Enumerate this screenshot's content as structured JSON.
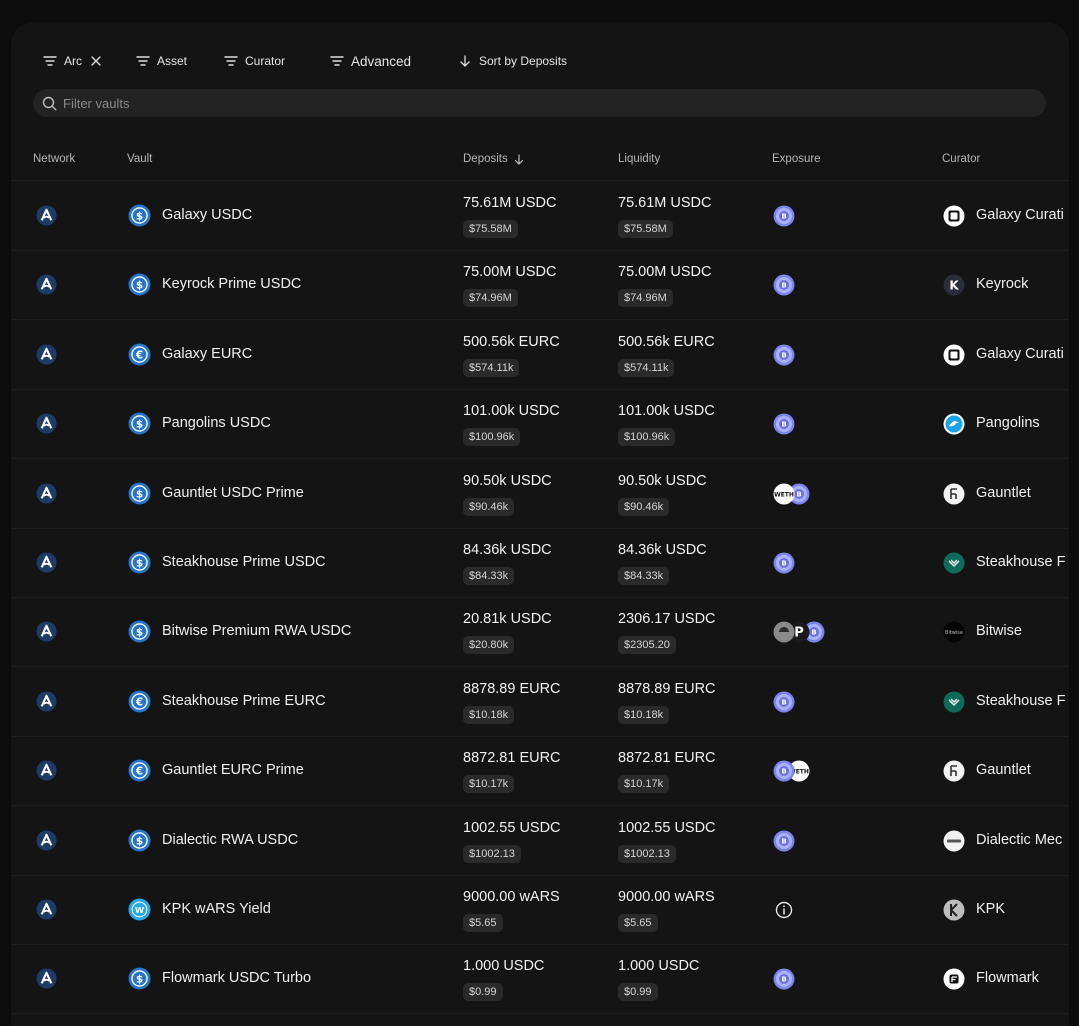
{
  "filters": {
    "network": "Arc",
    "asset": "Asset",
    "curator": "Curator",
    "advanced": "Advanced",
    "sort": "Sort by Deposits"
  },
  "search": {
    "placeholder": "Filter vaults",
    "value": ""
  },
  "columns": {
    "network": "Network",
    "vault": "Vault",
    "deposits": "Deposits",
    "liquidity": "Liquidity",
    "exposure": "Exposure",
    "curator": "Curator"
  },
  "colors": {
    "background": "#0c0c0c",
    "panel": "#141414",
    "usdc_blue": "#2775ca",
    "usd_pill": "#2a2a2a",
    "exposure_purple": "#7b84f0"
  },
  "rows": [
    {
      "network_icon": "arc-network-icon",
      "vault_icon": "usdc-icon",
      "vault": "Galaxy USDC",
      "deposits": "75.61M USDC",
      "deposits_usd": "$75.58M",
      "liquidity": "75.61M USDC",
      "liquidity_usd": "$75.58M",
      "exposure": [
        "rwa-token-icon"
      ],
      "curator_icon": "galaxy-icon",
      "curator": "Galaxy Curati"
    },
    {
      "network_icon": "arc-network-icon",
      "vault_icon": "usdc-icon",
      "vault": "Keyrock Prime USDC",
      "deposits": "75.00M USDC",
      "deposits_usd": "$74.96M",
      "liquidity": "75.00M USDC",
      "liquidity_usd": "$74.96M",
      "exposure": [
        "rwa-token-icon"
      ],
      "curator_icon": "keyrock-icon",
      "curator": "Keyrock"
    },
    {
      "network_icon": "arc-network-icon",
      "vault_icon": "eurc-icon",
      "vault": "Galaxy EURC",
      "deposits": "500.56k EURC",
      "deposits_usd": "$574.11k",
      "liquidity": "500.56k EURC",
      "liquidity_usd": "$574.11k",
      "exposure": [
        "rwa-token-icon"
      ],
      "curator_icon": "galaxy-icon",
      "curator": "Galaxy Curati"
    },
    {
      "network_icon": "arc-network-icon",
      "vault_icon": "usdc-icon",
      "vault": "Pangolins USDC",
      "deposits": "101.00k USDC",
      "deposits_usd": "$100.96k",
      "liquidity": "101.00k USDC",
      "liquidity_usd": "$100.96k",
      "exposure": [
        "rwa-token-icon"
      ],
      "curator_icon": "pangolins-icon",
      "curator": "Pangolins"
    },
    {
      "network_icon": "arc-network-icon",
      "vault_icon": "usdc-icon",
      "vault": "Gauntlet USDC Prime",
      "deposits": "90.50k USDC",
      "deposits_usd": "$90.46k",
      "liquidity": "90.50k USDC",
      "liquidity_usd": "$90.46k",
      "exposure": [
        "weth-icon",
        "rwa-token-icon"
      ],
      "curator_icon": "gauntlet-icon",
      "curator": "Gauntlet"
    },
    {
      "network_icon": "arc-network-icon",
      "vault_icon": "usdc-icon",
      "vault": "Steakhouse Prime USDC",
      "deposits": "84.36k USDC",
      "deposits_usd": "$84.33k",
      "liquidity": "84.36k USDC",
      "liquidity_usd": "$84.33k",
      "exposure": [
        "rwa-token-icon"
      ],
      "curator_icon": "steakhouse-icon",
      "curator": "Steakhouse F"
    },
    {
      "network_icon": "arc-network-icon",
      "vault_icon": "usdc-icon",
      "vault": "Bitwise Premium RWA USDC",
      "deposits": "20.81k USDC",
      "deposits_usd": "$20.80k",
      "liquidity": "2306.17 USDC",
      "liquidity_usd": "$2305.20",
      "exposure": [
        "grey-token-icon",
        "p-token-icon",
        "rwa-token-icon"
      ],
      "curator_icon": "bitwise-icon",
      "curator": "Bitwise"
    },
    {
      "network_icon": "arc-network-icon",
      "vault_icon": "eurc-icon",
      "vault": "Steakhouse Prime EURC",
      "deposits": "8878.89 EURC",
      "deposits_usd": "$10.18k",
      "liquidity": "8878.89 EURC",
      "liquidity_usd": "$10.18k",
      "exposure": [
        "rwa-token-icon"
      ],
      "curator_icon": "steakhouse-icon",
      "curator": "Steakhouse F"
    },
    {
      "network_icon": "arc-network-icon",
      "vault_icon": "eurc-icon",
      "vault": "Gauntlet EURC Prime",
      "deposits": "8872.81 EURC",
      "deposits_usd": "$10.17k",
      "liquidity": "8872.81 EURC",
      "liquidity_usd": "$10.17k",
      "exposure": [
        "rwa-token-icon",
        "weth-icon"
      ],
      "curator_icon": "gauntlet-icon",
      "curator": "Gauntlet"
    },
    {
      "network_icon": "arc-network-icon",
      "vault_icon": "usdc-icon",
      "vault": "Dialectic RWA USDC",
      "deposits": "1002.55 USDC",
      "deposits_usd": "$1002.13",
      "liquidity": "1002.55 USDC",
      "liquidity_usd": "$1002.13",
      "exposure": [
        "rwa-token-icon"
      ],
      "curator_icon": "dialectic-icon",
      "curator": "Dialectic Mec"
    },
    {
      "network_icon": "arc-network-icon",
      "vault_icon": "wars-icon",
      "vault": "KPK wARS Yield",
      "deposits": "9000.00 wARS",
      "deposits_usd": "$5.65",
      "liquidity": "9000.00 wARS",
      "liquidity_usd": "$5.65",
      "exposure": [
        "info-icon"
      ],
      "curator_icon": "kpk-icon",
      "curator": "KPK"
    },
    {
      "network_icon": "arc-network-icon",
      "vault_icon": "usdc-icon",
      "vault": "Flowmark USDC Turbo",
      "deposits": "1.000 USDC",
      "deposits_usd": "$0.99",
      "liquidity": "1.000 USDC",
      "liquidity_usd": "$0.99",
      "exposure": [
        "rwa-token-icon"
      ],
      "curator_icon": "flowmark-icon",
      "curator": "Flowmark"
    }
  ]
}
